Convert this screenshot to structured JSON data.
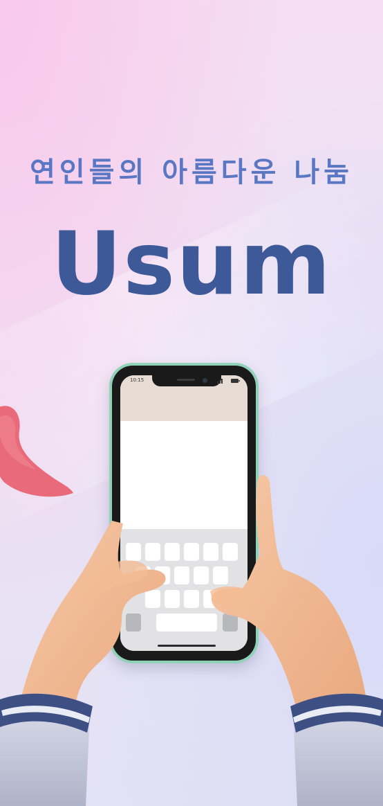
{
  "hero": {
    "tagline": "연인들의 아름다운 나눔",
    "brand": "Usum"
  },
  "phone": {
    "status_time": "10:15"
  },
  "colors": {
    "brand_blue": "#3d5998",
    "tagline_blue": "#5a77c4",
    "phone_frame": "#8fd2b8",
    "heart": "#e96a7a"
  },
  "icons": {
    "status": "signal-battery-icon",
    "heart": "heart-icon"
  }
}
